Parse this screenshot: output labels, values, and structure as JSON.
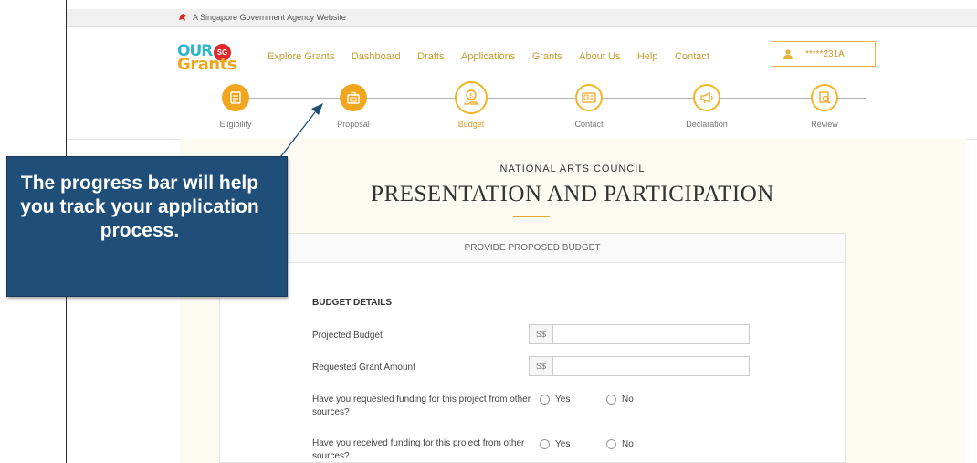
{
  "govbar": {
    "text": "A Singapore Government Agency Website"
  },
  "logo": {
    "our": "OUR",
    "sg": "SG",
    "grants": "Grants"
  },
  "nav": {
    "items": [
      "Explore Grants",
      "Dashboard",
      "Drafts",
      "Applications",
      "Grants",
      "About Us",
      "Help",
      "Contact"
    ]
  },
  "user": {
    "id": "*****231A"
  },
  "progress": {
    "steps": [
      {
        "label": "Eligibility",
        "icon": "checklist-icon",
        "state": "completed"
      },
      {
        "label": "Proposal",
        "icon": "briefcase-icon",
        "state": "completed"
      },
      {
        "label": "Budget",
        "icon": "money-hand-icon",
        "state": "active"
      },
      {
        "label": "Contact",
        "icon": "contact-card-icon",
        "state": "pending"
      },
      {
        "label": "Declaration",
        "icon": "megaphone-icon",
        "state": "pending"
      },
      {
        "label": "Review",
        "icon": "review-document-icon",
        "state": "pending"
      }
    ]
  },
  "page": {
    "agency": "NATIONAL ARTS COUNCIL",
    "title": "PRESENTATION AND PARTICIPATION"
  },
  "card": {
    "header": "PROVIDE PROPOSED BUDGET",
    "section": "BUDGET DETAILS",
    "fields": [
      {
        "label": "Projected Budget",
        "currency": "S$",
        "value": ""
      },
      {
        "label": "Requested Grant Amount",
        "currency": "S$",
        "value": ""
      }
    ],
    "questions": [
      {
        "label": "Have you requested funding for this project from other sources?",
        "yes": "Yes",
        "no": "No"
      },
      {
        "label": "Have you received funding for this project from other sources?",
        "yes": "Yes",
        "no": "No"
      }
    ]
  },
  "callout": {
    "text": "The progress bar will help you track your application process."
  },
  "colors": {
    "accent": "#f2a51e",
    "nav_link": "#c99a2e",
    "callout_bg": "#1f4e79"
  }
}
